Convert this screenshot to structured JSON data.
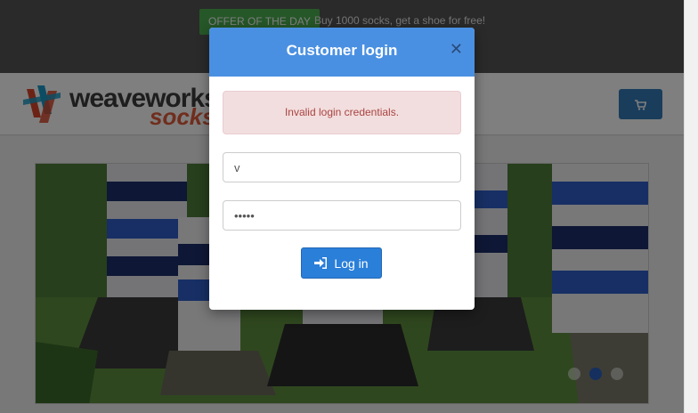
{
  "topbar": {
    "offer_badge": "OFFER OF THE DAY",
    "offer_text": "Buy 1000 socks, get a shoe for free!"
  },
  "header": {
    "brand_primary": "weaveworks",
    "brand_secondary": "socks",
    "cart_icon": "shopping-cart-icon"
  },
  "carousel": {
    "active_slide": 2,
    "slide_count": 3
  },
  "modal": {
    "title": "Customer login",
    "close_icon": "close-icon",
    "alert": "Invalid login credentials.",
    "username_value": "v",
    "password_value": "•••••",
    "login_label": "Log in",
    "login_icon": "sign-in-icon"
  },
  "colors": {
    "modal_header": "#4a90e2",
    "primary_button": "#2a7fd9",
    "alert_bg": "#f2dede",
    "alert_text": "#a94442",
    "offer_badge": "#4caf50"
  }
}
